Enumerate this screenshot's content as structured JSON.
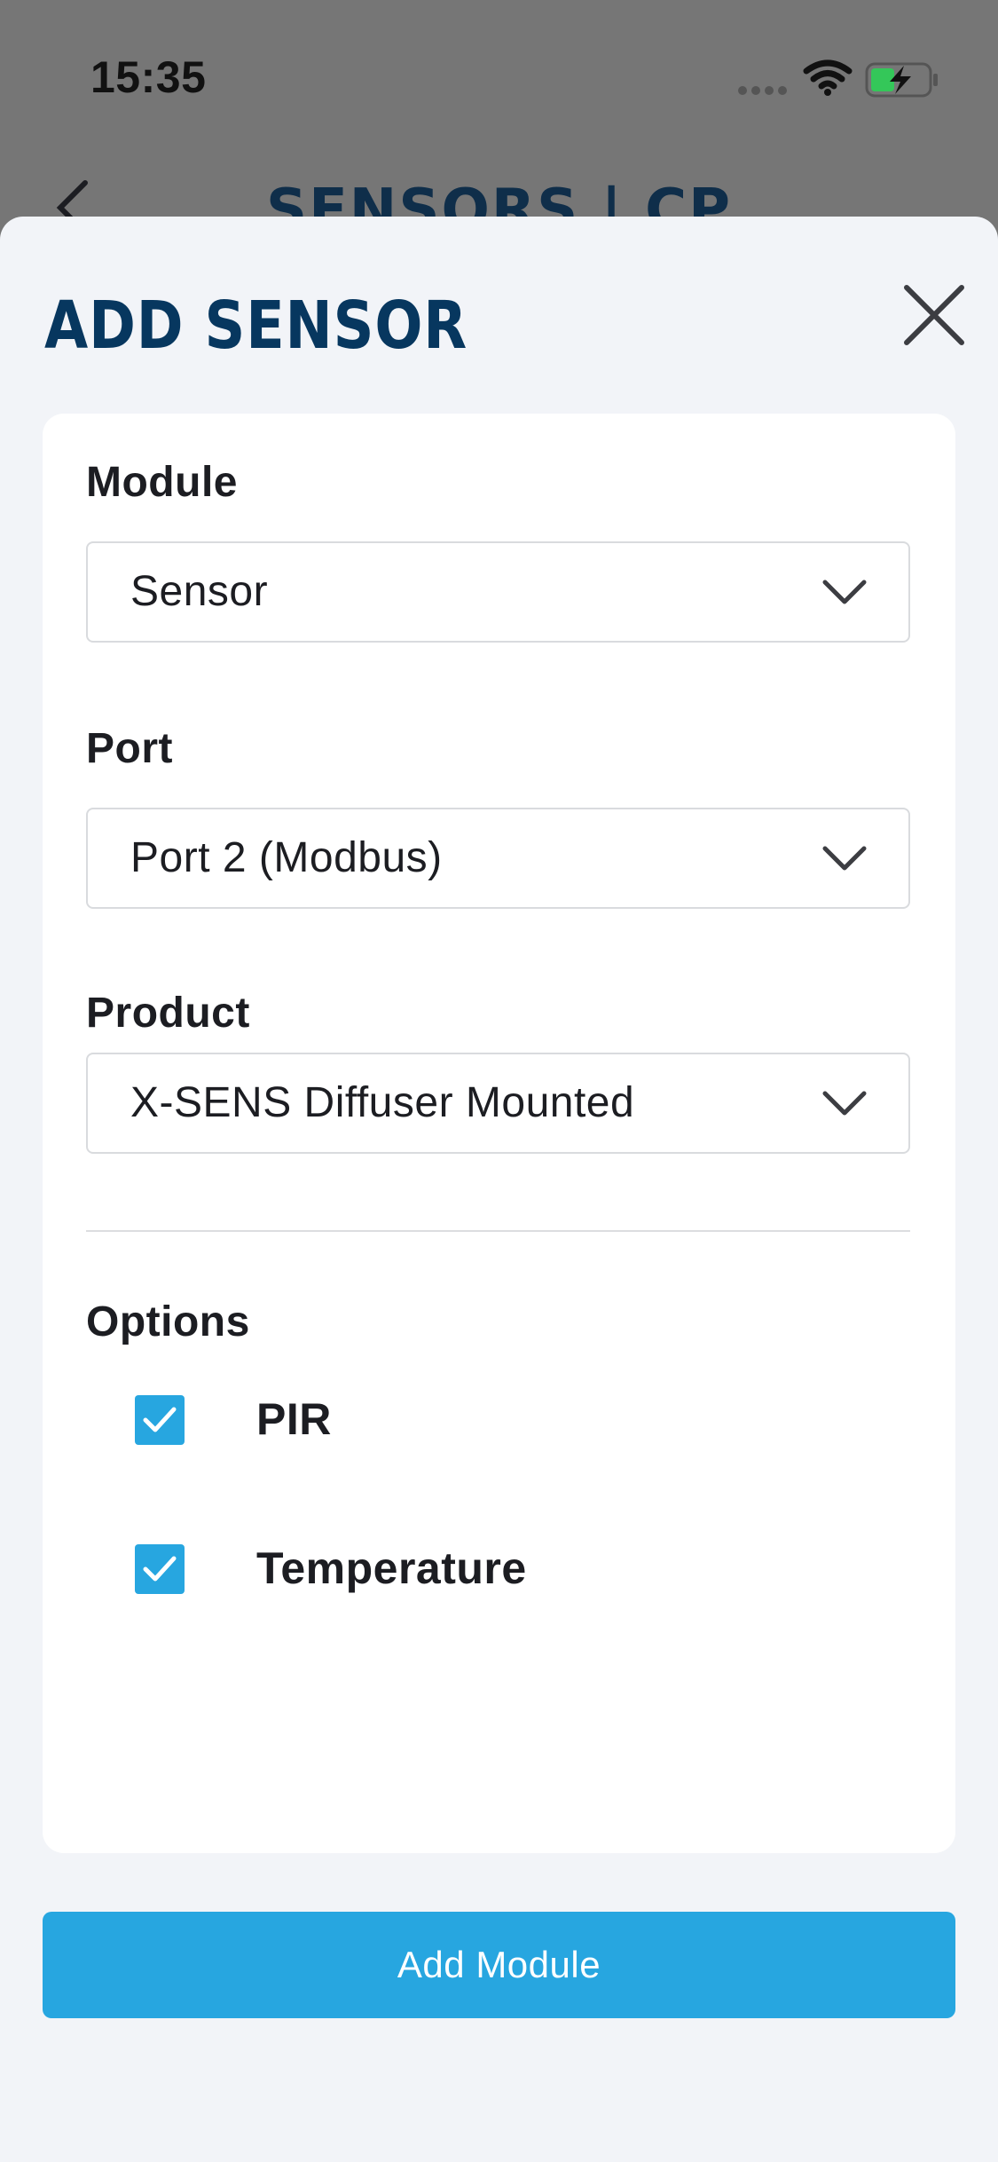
{
  "status_bar": {
    "time": "15:35",
    "icons": [
      "signal-dots-icon",
      "wifi-icon",
      "battery-charging-icon"
    ]
  },
  "background_screen": {
    "title": "SENSORS | CP",
    "back_icon": "chevron-left-icon"
  },
  "sheet": {
    "title": "ADD SENSOR",
    "close_icon": "close-icon",
    "fields": {
      "module": {
        "label": "Module",
        "value": "Sensor"
      },
      "port": {
        "label": "Port",
        "value": "Port 2 (Modbus)"
      },
      "product": {
        "label": "Product",
        "value": "X-SENS Diffuser Mounted"
      }
    },
    "options": {
      "label": "Options",
      "items": [
        {
          "label": "PIR",
          "checked": true
        },
        {
          "label": "Temperature",
          "checked": true
        }
      ]
    },
    "submit_label": "Add Module"
  },
  "colors": {
    "accent": "#27a6e0",
    "title_navy": "#07375f",
    "sheet_background": "#f2f4f8",
    "overlay": "#767676"
  }
}
